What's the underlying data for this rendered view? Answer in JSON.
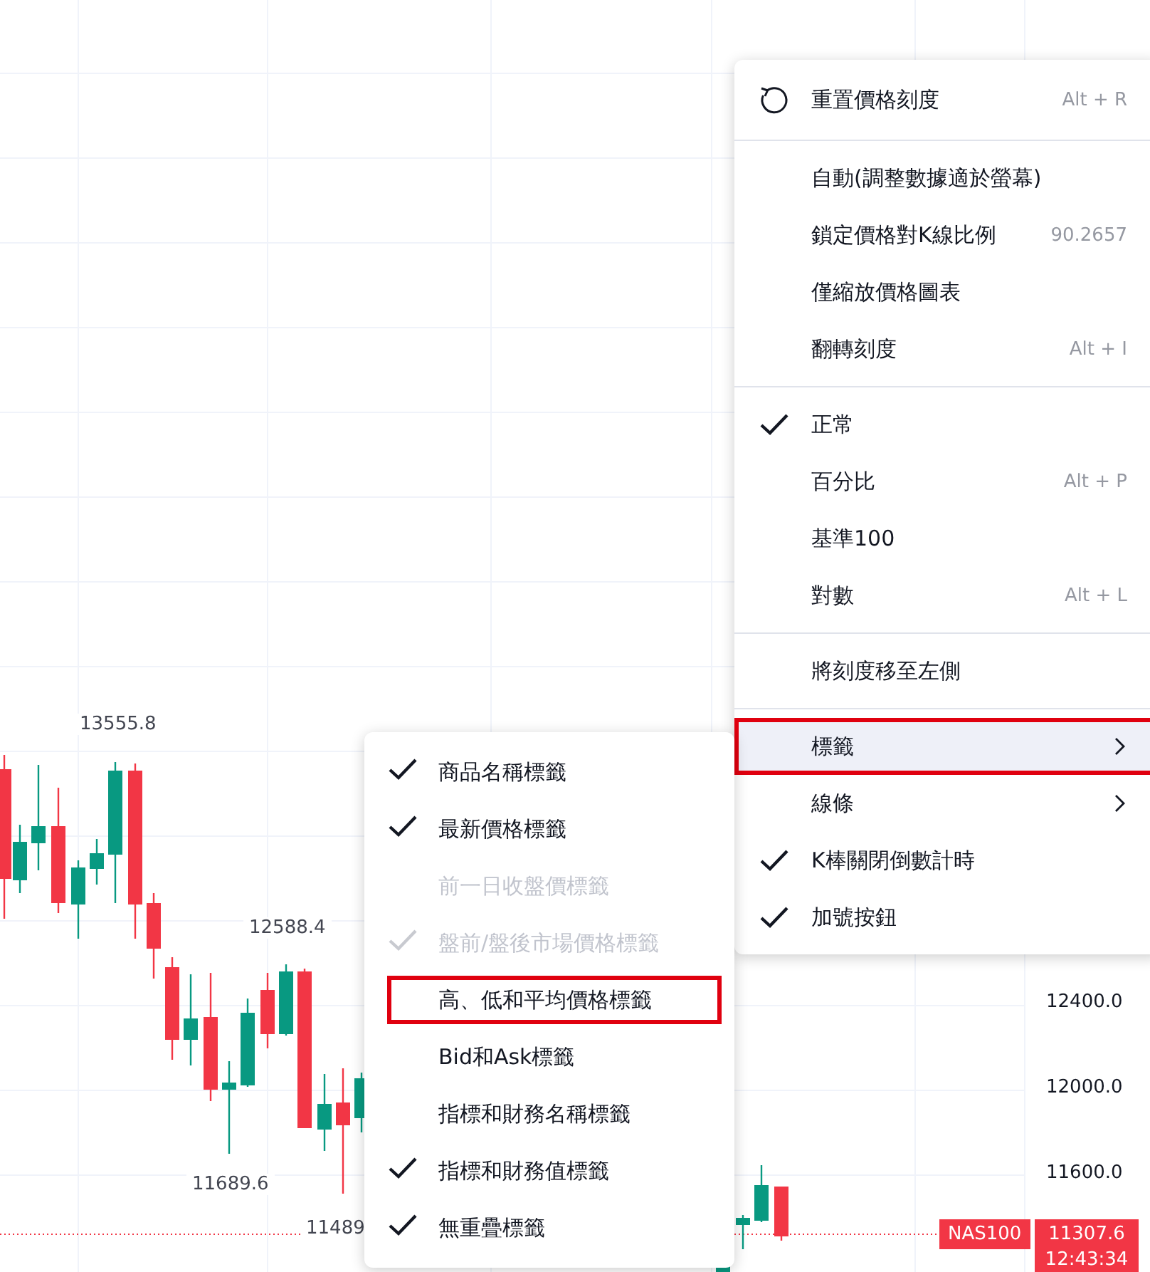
{
  "chart": {
    "annotations": [
      "13555.8",
      "12588.4",
      "11689.6",
      "11489"
    ],
    "price_axis": [
      "12400.0",
      "12000.0",
      "11600.0"
    ],
    "symbol_badge": "NAS100",
    "last_price": "11307.6",
    "countdown": "12:43:34"
  },
  "context_menu": {
    "sections": [
      [
        {
          "kind": "reset",
          "label": "重置價格刻度",
          "shortcut": "Alt + R",
          "hovered": false,
          "outlined": false
        }
      ],
      [
        {
          "kind": "action",
          "label": "自動(調整數據適於螢幕)",
          "checked": false,
          "hovered": false,
          "outlined": false
        },
        {
          "kind": "action",
          "label": "鎖定價格對K線比例",
          "shortcut": "90.2657",
          "checked": false,
          "hovered": false,
          "outlined": false
        },
        {
          "kind": "action",
          "label": "僅縮放價格圖表",
          "checked": false,
          "hovered": false,
          "outlined": false
        },
        {
          "kind": "action",
          "label": "翻轉刻度",
          "shortcut": "Alt + I",
          "checked": false,
          "hovered": false,
          "outlined": false
        }
      ],
      [
        {
          "kind": "action",
          "label": "正常",
          "checked": true,
          "hovered": false,
          "outlined": false
        },
        {
          "kind": "action",
          "label": "百分比",
          "shortcut": "Alt + P",
          "checked": false,
          "hovered": false,
          "outlined": false
        },
        {
          "kind": "action",
          "label": "基準100",
          "checked": false,
          "hovered": false,
          "outlined": false
        },
        {
          "kind": "action",
          "label": "對數",
          "shortcut": "Alt + L",
          "checked": false,
          "hovered": false,
          "outlined": false
        }
      ],
      [
        {
          "kind": "action",
          "label": "將刻度移至左側",
          "checked": false,
          "hovered": false,
          "outlined": false
        }
      ],
      [
        {
          "kind": "submenu",
          "label": "標籤",
          "checked": false,
          "hovered": true,
          "outlined": true
        },
        {
          "kind": "submenu",
          "label": "線條",
          "checked": false,
          "hovered": false,
          "outlined": false
        },
        {
          "kind": "action",
          "label": "K棒關閉倒數計時",
          "checked": true,
          "hovered": false,
          "outlined": false
        },
        {
          "kind": "action",
          "label": "加號按鈕",
          "checked": true,
          "hovered": false,
          "outlined": false
        }
      ]
    ]
  },
  "labels_submenu": {
    "items": [
      {
        "label": "商品名稱標籤",
        "checked": true,
        "disabled": false,
        "outlined": false
      },
      {
        "label": "最新價格標籤",
        "checked": true,
        "disabled": false,
        "outlined": false
      },
      {
        "label": "前一日收盤價標籤",
        "checked": false,
        "disabled": true,
        "outlined": false
      },
      {
        "label": "盤前/盤後市場價格標籤",
        "checked": true,
        "disabled": true,
        "outlined": false
      },
      {
        "label": "高、低和平均價格標籤",
        "checked": false,
        "disabled": false,
        "outlined": true
      },
      {
        "label": "Bid和Ask標籤",
        "checked": false,
        "disabled": false,
        "outlined": false
      },
      {
        "label": "指標和財務名稱標籤",
        "checked": false,
        "disabled": false,
        "outlined": false
      },
      {
        "label": "指標和財務值標籤",
        "checked": true,
        "disabled": false,
        "outlined": false
      },
      {
        "label": "無重疊標籤",
        "checked": true,
        "disabled": false,
        "outlined": false
      }
    ]
  }
}
